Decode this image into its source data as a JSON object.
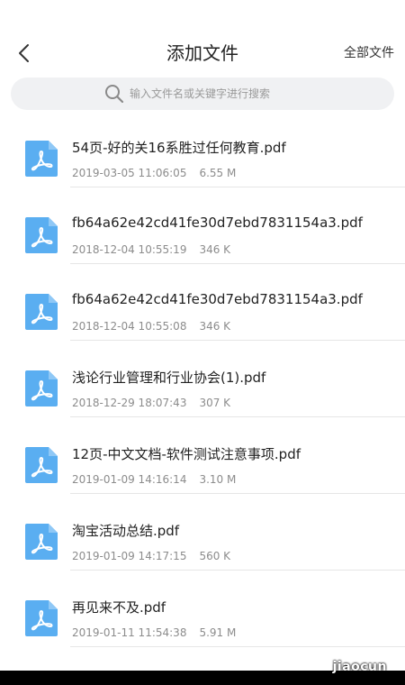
{
  "header": {
    "title": "添加文件",
    "right_action": "全部文件"
  },
  "search": {
    "placeholder": "输入文件名或关键字进行搜索"
  },
  "colors": {
    "pdf_icon": "#5aaef1",
    "divider": "#e6e6e6",
    "meta_text": "#8c8c8c"
  },
  "files": [
    {
      "name": "54页-好的关16系胜过任何教育.pdf",
      "datetime": "2019-03-05 11:06:05",
      "size": "6.55 M",
      "icon": "pdf-icon"
    },
    {
      "name": "fb64a62e42cd41fe30d7ebd7831154a3.pdf",
      "datetime": "2018-12-04 10:55:19",
      "size": "346 K",
      "icon": "pdf-icon"
    },
    {
      "name": "fb64a62e42cd41fe30d7ebd7831154a3.pdf",
      "datetime": "2018-12-04 10:55:08",
      "size": "346 K",
      "icon": "pdf-icon"
    },
    {
      "name": "浅论行业管理和行业协会(1).pdf",
      "datetime": "2018-12-29 18:07:43",
      "size": "307 K",
      "icon": "pdf-icon"
    },
    {
      "name": "12页-中文文档-软件测试注意事项.pdf",
      "datetime": "2019-01-09 14:16:14",
      "size": "3.10 M",
      "icon": "pdf-icon"
    },
    {
      "name": "淘宝活动总结.pdf",
      "datetime": "2019-01-09 14:17:15",
      "size": "560 K",
      "icon": "pdf-icon"
    },
    {
      "name": "再见来不及.pdf",
      "datetime": "2019-01-11 11:54:38",
      "size": "5.91 M",
      "icon": "pdf-icon"
    }
  ],
  "watermark": "jiaocun"
}
